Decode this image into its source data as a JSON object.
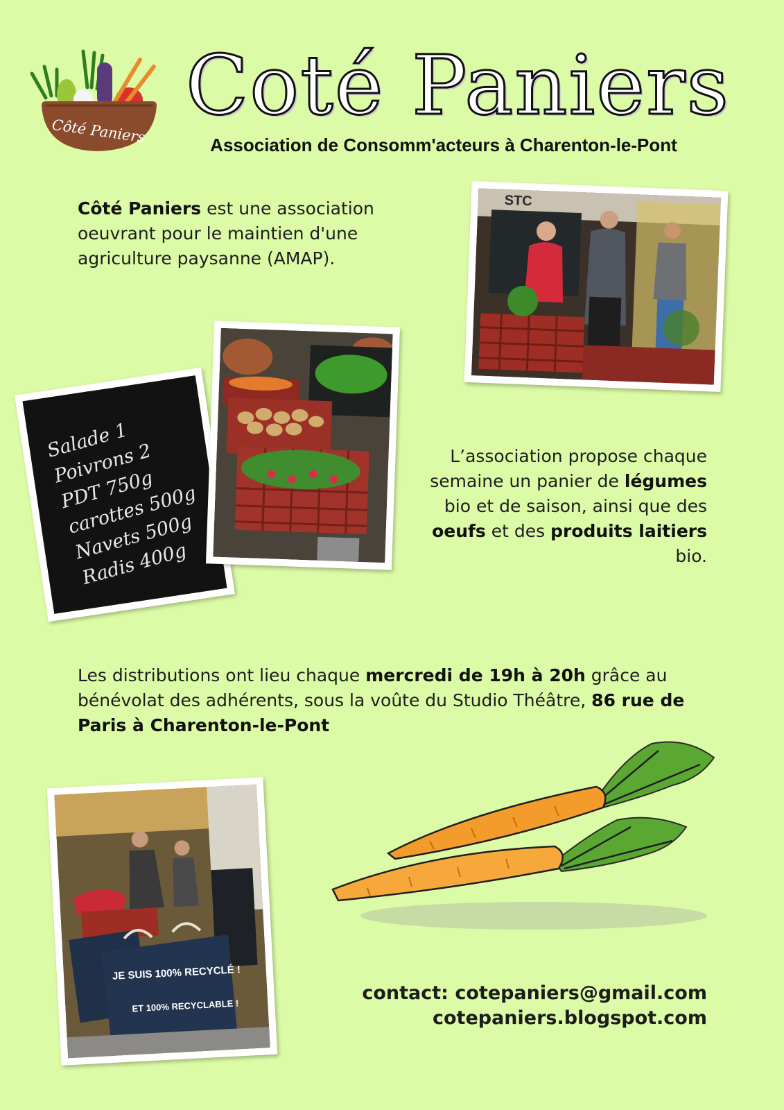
{
  "header": {
    "title": "Coté Paniers",
    "logo_text": "Côté Paniers",
    "subtitle": "Association de Consomm'acteurs à Charenton-le-Pont"
  },
  "intro": {
    "name": "Côté Paniers",
    "text": " est une association oeuvrant pour le maintien d'une agriculture paysanne (AMAP)."
  },
  "offer": {
    "t1": "L’association propose chaque semaine un panier de ",
    "b1": "légumes",
    "t2": " bio et de saison, ainsi que des ",
    "b2": "oeufs",
    "t3": " et des ",
    "b3": "produits laitiers",
    "t4": " bio."
  },
  "distribution": {
    "t1": "Les distributions ont lieu chaque ",
    "b1": "mercredi de 19h à 20h",
    "t2": " grâce au bénévolat des adhérents, sous la voûte du Studio Théâtre, ",
    "b2": "86 rue de Paris à Charenton-le-Pont"
  },
  "chalkboard": {
    "lines": [
      "Salade 1",
      "Poivrons 2",
      "PDT 750g",
      "carottes 500g",
      "Navets 500g",
      "Radis 400g"
    ]
  },
  "photo_labels": {
    "sign": "STC",
    "bag_line_1": "JE SUIS 100% RECYCLÉ !",
    "bag_line_2": "ET 100% RECYCLABLE !"
  },
  "contact": {
    "email_line": "contact: cotepaniers@gmail.com",
    "blog_line": "cotepaniers.blogspot.com"
  },
  "colors": {
    "background": "#dcfba6",
    "basket": "#8a4a2c",
    "carrot": "#f39c2c",
    "leaf": "#5aa832"
  }
}
